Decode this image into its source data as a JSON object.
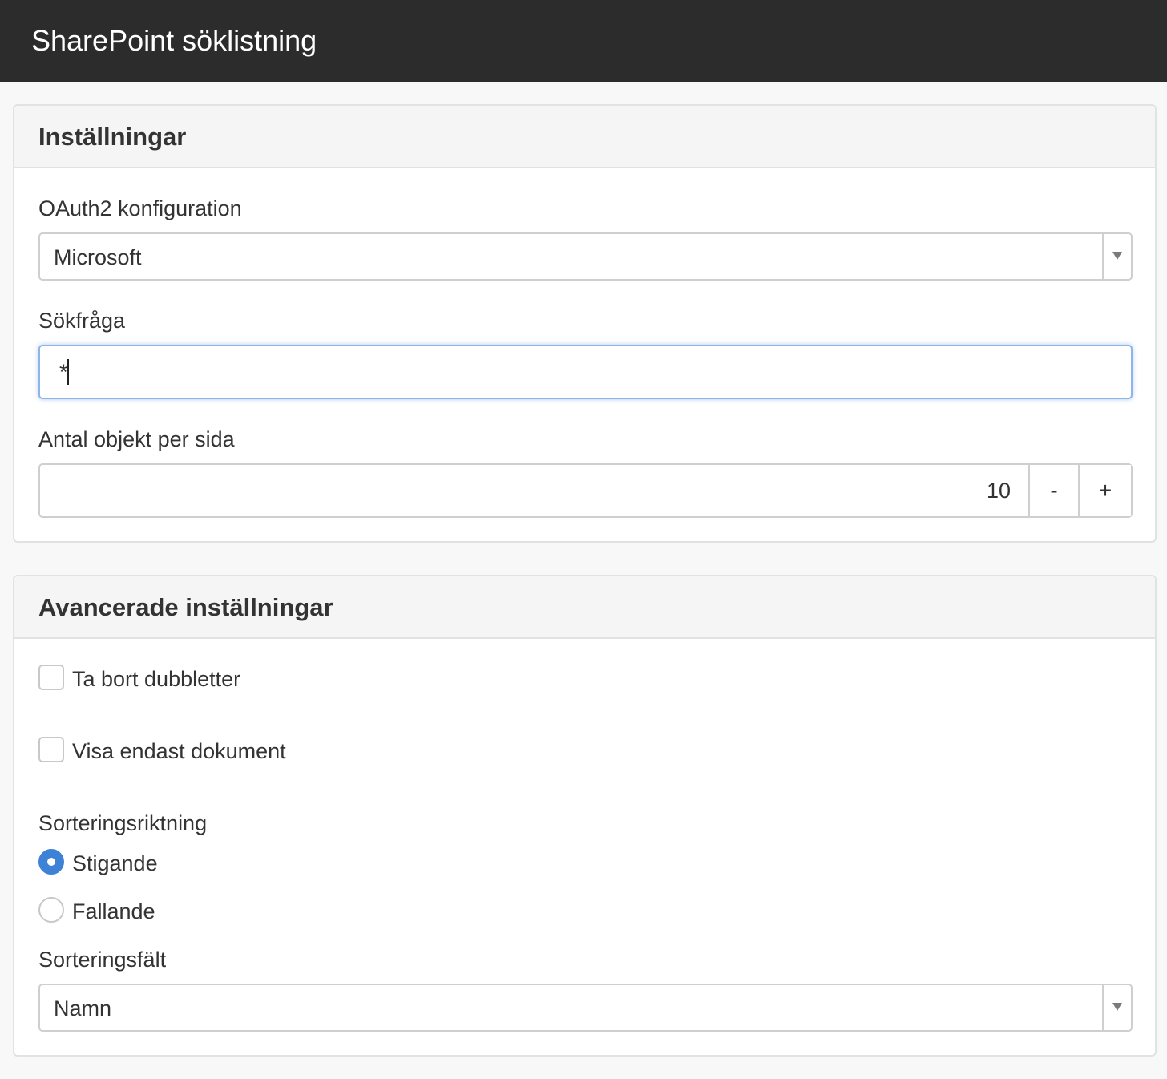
{
  "header": {
    "title": "SharePoint söklistning"
  },
  "settings": {
    "heading": "Inställningar",
    "oauth_label": "OAuth2 konfiguration",
    "oauth_value": "Microsoft",
    "query_label": "Sökfråga",
    "query_value": "*",
    "items_label": "Antal objekt per sida",
    "items_value": "10",
    "decrement_label": "-",
    "increment_label": "+"
  },
  "advanced": {
    "heading": "Avancerade inställningar",
    "remove_duplicates_label": "Ta bort dubbletter",
    "remove_duplicates_checked": false,
    "documents_only_label": "Visa endast dokument",
    "documents_only_checked": false,
    "sort_direction_label": "Sorteringsriktning",
    "sort_direction_options": [
      {
        "label": "Stigande",
        "selected": true
      },
      {
        "label": "Fallande",
        "selected": false
      }
    ],
    "sort_field_label": "Sorteringsfält",
    "sort_field_value": "Namn"
  },
  "colors": {
    "header_bg": "#2c2c2c",
    "accent": "#3d82d6",
    "focus_border": "#8db5e8"
  },
  "icons": {
    "select_arrow": "triangle-down-icon"
  }
}
